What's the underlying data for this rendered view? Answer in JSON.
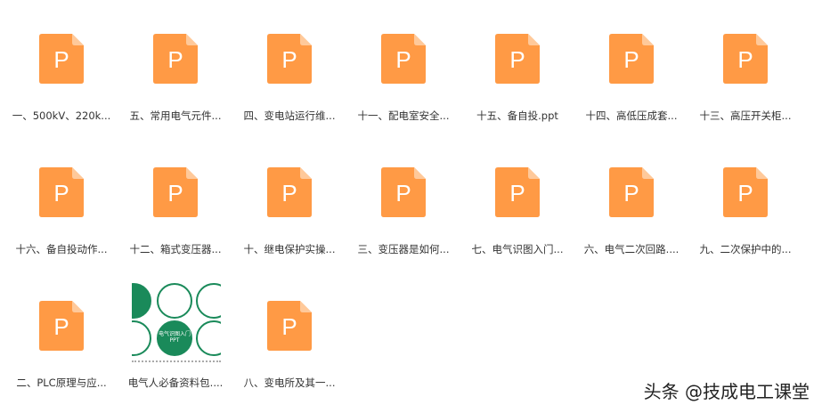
{
  "files": [
    {
      "label": "一、500kV、220k...",
      "type": "ppt"
    },
    {
      "label": "五、常用电气元件...",
      "type": "ppt"
    },
    {
      "label": "四、变电站运行维...",
      "type": "ppt"
    },
    {
      "label": "十一、配电室安全...",
      "type": "ppt"
    },
    {
      "label": "十五、备自投.ppt",
      "type": "ppt"
    },
    {
      "label": "十四、高低压成套...",
      "type": "ppt"
    },
    {
      "label": "十三、高压开关柜...",
      "type": "ppt"
    },
    {
      "label": "十六、备自投动作...",
      "type": "ppt"
    },
    {
      "label": "十二、箱式变压器...",
      "type": "ppt"
    },
    {
      "label": "十、继电保护实操...",
      "type": "ppt"
    },
    {
      "label": "三、变压器是如何...",
      "type": "ppt"
    },
    {
      "label": "七、电气识图入门...",
      "type": "ppt"
    },
    {
      "label": "六、电气二次回路....",
      "type": "ppt"
    },
    {
      "label": "九、二次保护中的...",
      "type": "ppt"
    },
    {
      "label": "二、PLC原理与应...",
      "type": "ppt"
    },
    {
      "label": "电气人必备资料包....",
      "type": "image",
      "thumb_center_text": "电气识图入门PPT"
    },
    {
      "label": "八、变电所及其一...",
      "type": "ppt"
    }
  ],
  "icon_letter": "P",
  "colors": {
    "ppt": "#FF9A45",
    "ppt_fold": "#FFC99A",
    "thumb_green": "#1a8a5a"
  },
  "watermark": "头条 @技成电工课堂"
}
